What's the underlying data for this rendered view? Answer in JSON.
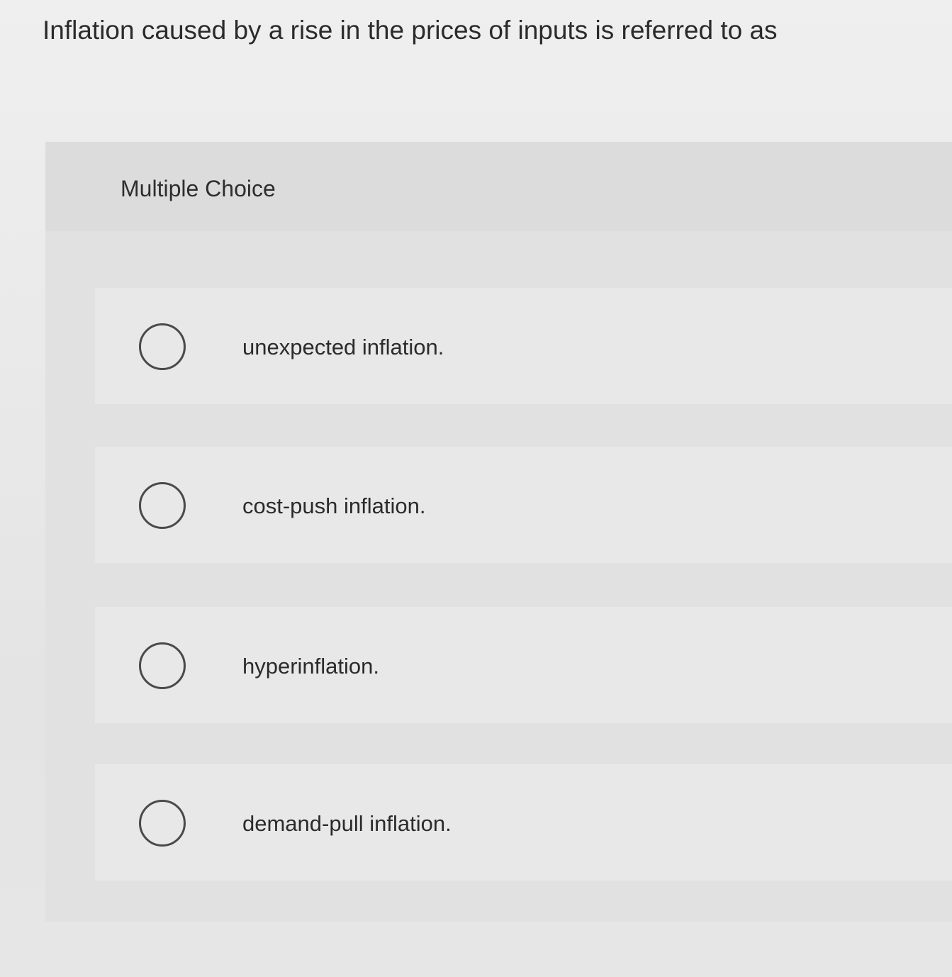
{
  "question": {
    "text": "Inflation caused by a rise in the prices of inputs is referred to as"
  },
  "multiple_choice": {
    "header_label": "Multiple Choice",
    "options": [
      {
        "label": "unexpected inflation.",
        "selected": false
      },
      {
        "label": "cost-push inflation.",
        "selected": false
      },
      {
        "label": "hyperinflation.",
        "selected": false
      },
      {
        "label": "demand-pull inflation.",
        "selected": false
      }
    ]
  },
  "colors": {
    "background": "#ececec",
    "panel": "#e1e1e1",
    "header": "#dcdcdc",
    "option_row": "#e8e8e8",
    "text": "#2b2b2b",
    "radio_border": "#4a4a4a"
  },
  "icons": {
    "radio": "radio-unselected-icon"
  }
}
